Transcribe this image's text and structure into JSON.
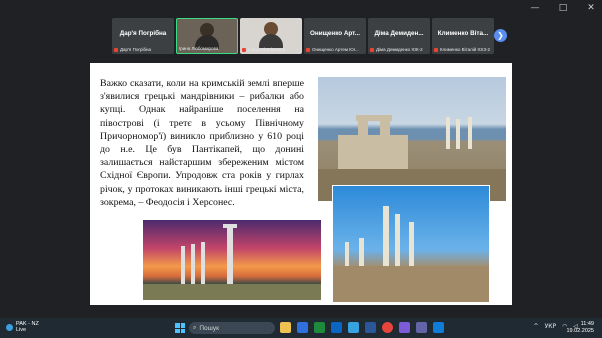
{
  "window": {
    "controls": [
      "—",
      "□",
      "✕"
    ]
  },
  "participants": [
    {
      "name": "Дар'я Погрібна",
      "caption": "Дар'я Погрібна",
      "type": "name"
    },
    {
      "name": "",
      "caption": "Ірина Любомирова",
      "type": "video"
    },
    {
      "name": "",
      "caption": "Lesya Khudutsana",
      "type": "video2"
    },
    {
      "name": "Онищенко Арт...",
      "caption": "Онищенко Артем ЮІ...",
      "type": "name"
    },
    {
      "name": "Діма Демиден...",
      "caption": "Діма Демиденко ЮК-2",
      "type": "name"
    },
    {
      "name": "Клименко Віта...",
      "caption": "Клименко Віталій ЮІЗ-2",
      "type": "name"
    }
  ],
  "slide": {
    "text": "Важко сказати, коли на кримській землі вперше з'явилися грецькі мандрівники – рибалки або купці. Однак найраніше поселення на півострові (і третє в усьому Північному Причорномор'ї) виникло приблизно у 610 році до н.е. Це був Пантікапей, що донині залишається найстаршим збереженим містом Східної Європи. Упродовж ста років у гирлах річок, у протоках виникають інші грецькі міста, зокрема, – Феодосія і Херсонес."
  },
  "taskbar": {
    "weather_title": "PAK - NZ",
    "weather_sub": "Live",
    "search_placeholder": "Пошук",
    "language": "УКР",
    "time": "11:49",
    "date": "19.02.2025"
  },
  "colors": {
    "accent": "#5b8def",
    "active_border": "#3ddc84",
    "mic_muted": "#ea4335"
  }
}
